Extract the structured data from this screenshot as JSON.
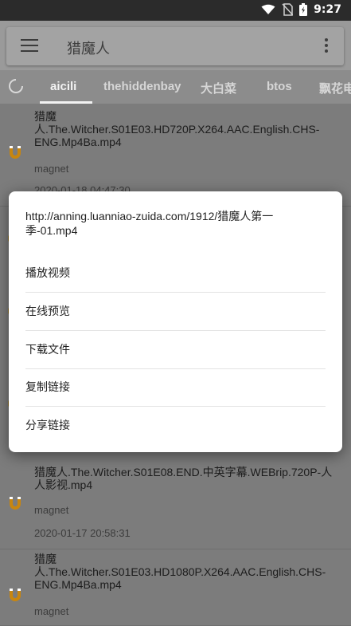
{
  "status": {
    "time": "9:27"
  },
  "search": {
    "title": "猎魔人"
  },
  "tabs": [
    "aicili",
    "thehiddenbay",
    "大白菜",
    "btos",
    "飘花电影"
  ],
  "results": [
    {
      "title": "猎魔人.The.Witcher.S01E03.HD720P.X264.AAC.English.CHS-ENG.Mp4Ba.mp4",
      "type": "magnet",
      "date": "2020-01-18 04:47:30"
    },
    {
      "title": "猎魔人.The.Witcher.S01E08.END.中英字幕.WEBrip.720P-人人影视.mp4",
      "type": "magnet",
      "date": "2020-01-17 20:58:31"
    },
    {
      "title": "猎魔人.The.Witcher.S01E03.HD1080P.X264.AAC.English.CHS-ENG.Mp4Ba.mp4",
      "type": "magnet"
    }
  ],
  "dialog": {
    "url": "http://anning.luanniao-zuida.com/1912/猎魔人第一季-01.mp4",
    "options": [
      "播放视频",
      "在线预览",
      "下载文件",
      "复制链接",
      "分享链接"
    ]
  },
  "colors": {
    "magnet": "#c8860f",
    "dialog_bg": "#ffffff"
  }
}
